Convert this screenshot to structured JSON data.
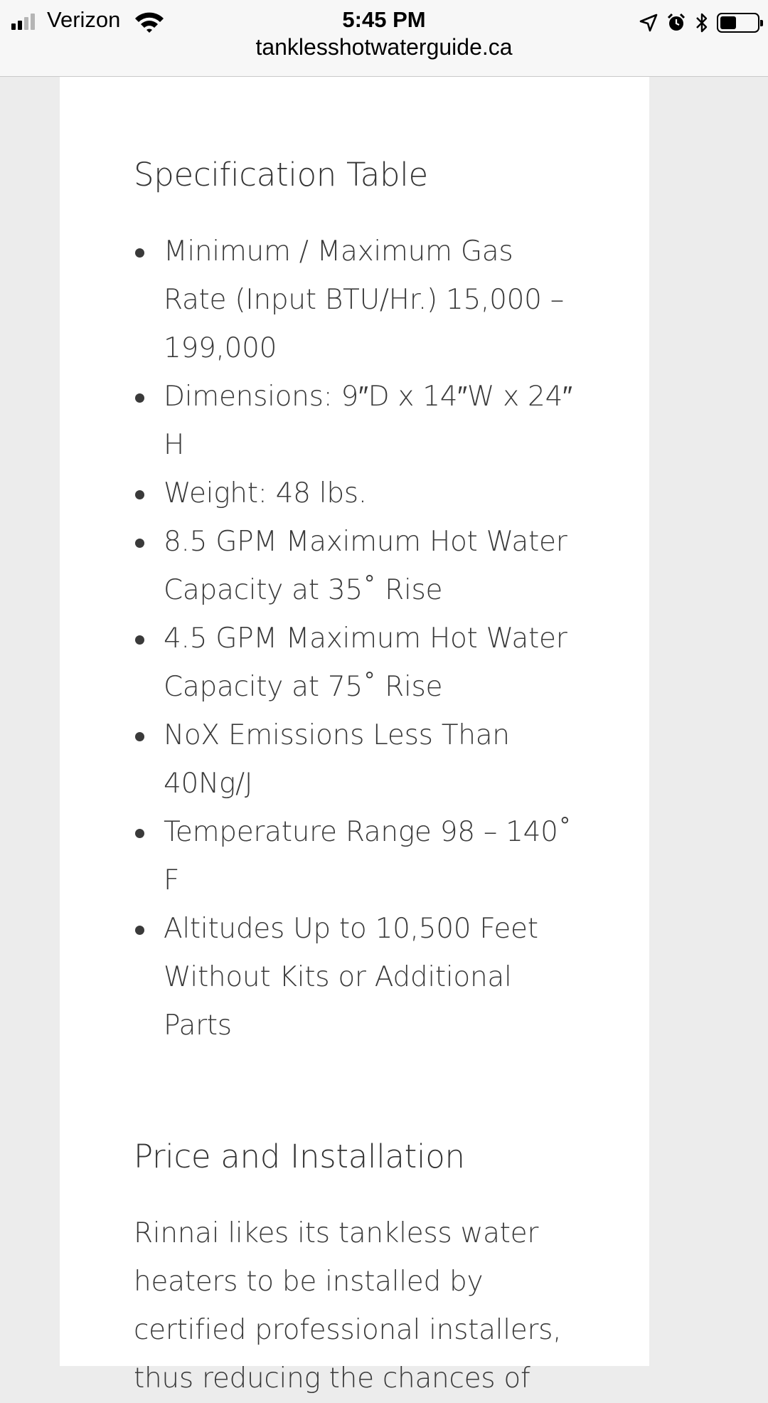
{
  "status_bar": {
    "carrier": "Verizon",
    "time": "5:45 PM",
    "battery_level": 0.4,
    "signal_bars_active": 2,
    "signal_bars_total": 4,
    "icons": [
      "signal-icon",
      "wifi-icon",
      "location-arrow-icon",
      "alarm-icon",
      "bluetooth-icon",
      "battery-icon"
    ]
  },
  "browser": {
    "url": "tanklesshotwaterguide.ca"
  },
  "article": {
    "spec_heading": "Specification Table",
    "spec_items": [
      "Minimum / Maximum Gas Rate (Input BTU/Hr.) 15,000 – 199,000",
      "Dimensions: 9″D x 14″W x 24″ H",
      "Weight: 48 lbs.",
      "8.5 GPM Maximum Hot Water Capacity at 35˚ Rise",
      "4.5 GPM Maximum Hot Water Capacity at 75˚ Rise",
      "NoX Emissions Less Than 40Ng/J",
      "Temperature Range 98 – 140˚ F",
      "Altitudes Up to 10,500 Feet Without Kits or Additional Parts"
    ],
    "price_heading": "Price and Installation",
    "price_paragraph": "Rinnai likes its tankless water heaters to be installed by certified professional installers, thus reducing the chances of"
  },
  "colors": {
    "page_background": "#ececec",
    "card_background": "#ffffff",
    "text": "#3a3a3a",
    "status_bar_background": "#f7f7f7"
  }
}
